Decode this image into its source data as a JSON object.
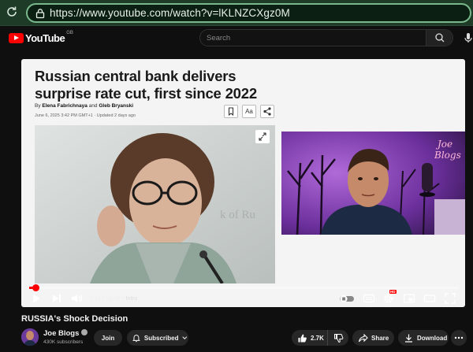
{
  "browser": {
    "url": "https://www.youtube.com/watch?v=lKLNZCXgz0M",
    "reload_icon": "reload-icon",
    "site_info_icon": "site-info-icon"
  },
  "header": {
    "logo_text": "YouTube",
    "country_code": "GB",
    "search_placeholder": "Search"
  },
  "article": {
    "title": "Russian central bank delivers surprise rate cut, first since 2022",
    "by_prefix": "By",
    "author1": "Elena Fabrichnaya",
    "and_text": "and",
    "author2": "Gleb Bryanski",
    "dateline": "June 6, 2025 3:42 PM GMT+1 · Updated 2 days ago",
    "text_size_label": "Aa"
  },
  "overlay": {
    "neon_sign_line1": "Joe",
    "neon_sign_line2": "Blogs"
  },
  "player": {
    "current_time": "0:14",
    "duration": "16:58",
    "time_separator": " / ",
    "chapter": "Intro",
    "progress_fraction": 0.014,
    "hd_badge": "HD"
  },
  "video": {
    "title": "RUSSIA's Shock Decision",
    "channel_name": "Joe Blogs",
    "subscribers": "430K subscribers",
    "join_label": "Join",
    "subscribed_label": "Subscribed",
    "likes": "2.7K",
    "share_label": "Share",
    "download_label": "Download"
  },
  "colors": {
    "accent_red": "#ff0000",
    "browser_bar": "#1d3b27",
    "background": "#0f0f0f"
  }
}
